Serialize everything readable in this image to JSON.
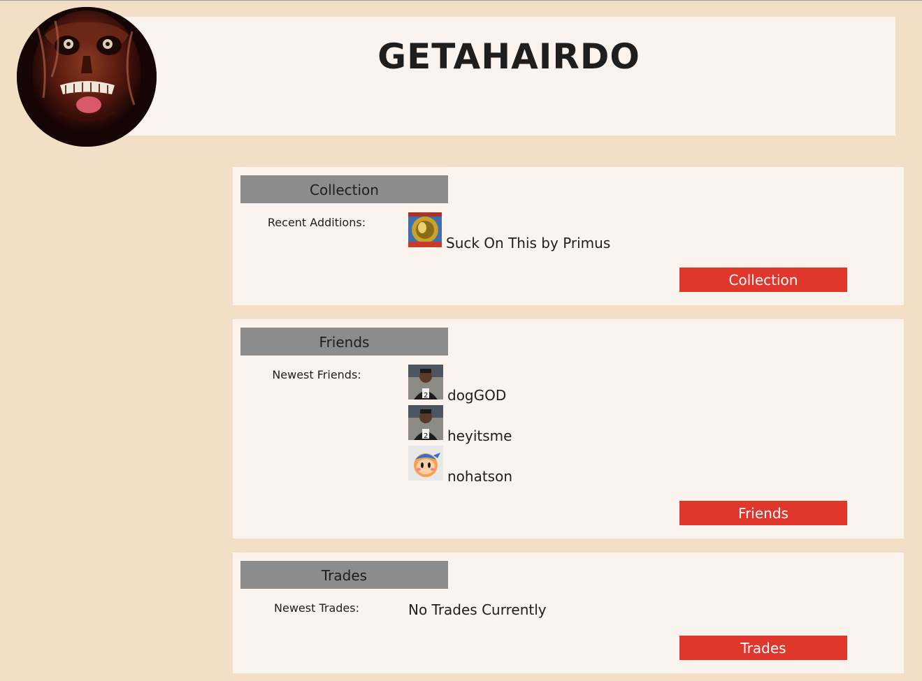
{
  "profile": {
    "username": "GETAHAIRDO"
  },
  "collection": {
    "title": "Collection",
    "label": "Recent Additions:",
    "items": [
      {
        "text": "Suck On This by Primus",
        "icon": "album-cover-icon"
      }
    ],
    "button_label": "Collection"
  },
  "friends": {
    "title": "Friends",
    "label": "Newest Friends:",
    "items": [
      {
        "name": "dogGOD",
        "icon": "friend-avatar-icon"
      },
      {
        "name": "heyitsme",
        "icon": "friend-avatar-icon"
      },
      {
        "name": "nohatson",
        "icon": "friend-avatar-icon"
      }
    ],
    "button_label": "Friends"
  },
  "trades": {
    "title": "Trades",
    "label": "Newest Trades:",
    "empty_text": "No Trades Currently",
    "button_label": "Trades"
  },
  "colors": {
    "page_background": "#f2dfc6",
    "panel_background": "#faf3ee",
    "section_header": "#8c8c8c",
    "button": "#e0372c"
  }
}
